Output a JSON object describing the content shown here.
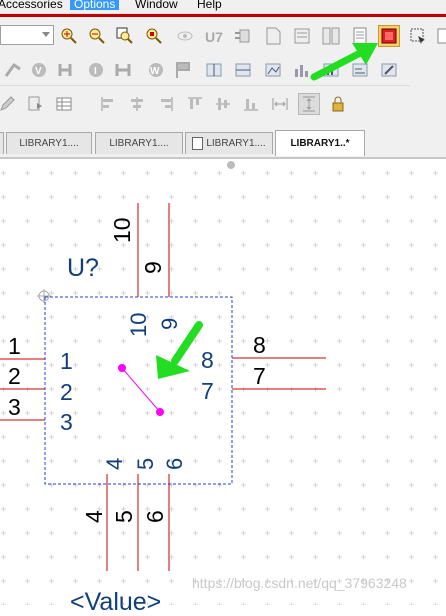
{
  "menu": {
    "items": [
      "Accessories",
      "Options",
      "Window",
      "Help"
    ],
    "active": "Options"
  },
  "toolbar": {
    "icons": [
      "zoom-in-icon",
      "zoom-out-icon",
      "zoom-area-icon",
      "zoom-all-icon",
      "eye-icon",
      "part-icon",
      "pin-icon",
      "page-icon",
      "sheet-icon",
      "grid-icon",
      "document-icon",
      "highlighted-toggle-icon",
      "select-icon"
    ]
  },
  "tabs": [
    {
      "label": "LIBRARY1...."
    },
    {
      "label": "LIBRARY1...."
    },
    {
      "label": "LIBRARY1...."
    },
    {
      "label": "LIBRARY1..*",
      "active": true
    }
  ],
  "schematic": {
    "ref": "U?",
    "value": "<Value>",
    "pins_left": [
      "1",
      "2",
      "3"
    ],
    "pins_right": [
      "8",
      "7"
    ],
    "pins_top": [
      "10",
      "9"
    ],
    "pins_bottom": [
      "4",
      "5",
      "6"
    ]
  },
  "watermark": "https://blog.csdn.net/qq_37963248",
  "colors": {
    "arrow": "#22dd22",
    "pin_line": "#cc0000",
    "body_border": "#2a3fd6",
    "pin_number_inside": "#123f7a",
    "dot": "#ff00ff"
  }
}
